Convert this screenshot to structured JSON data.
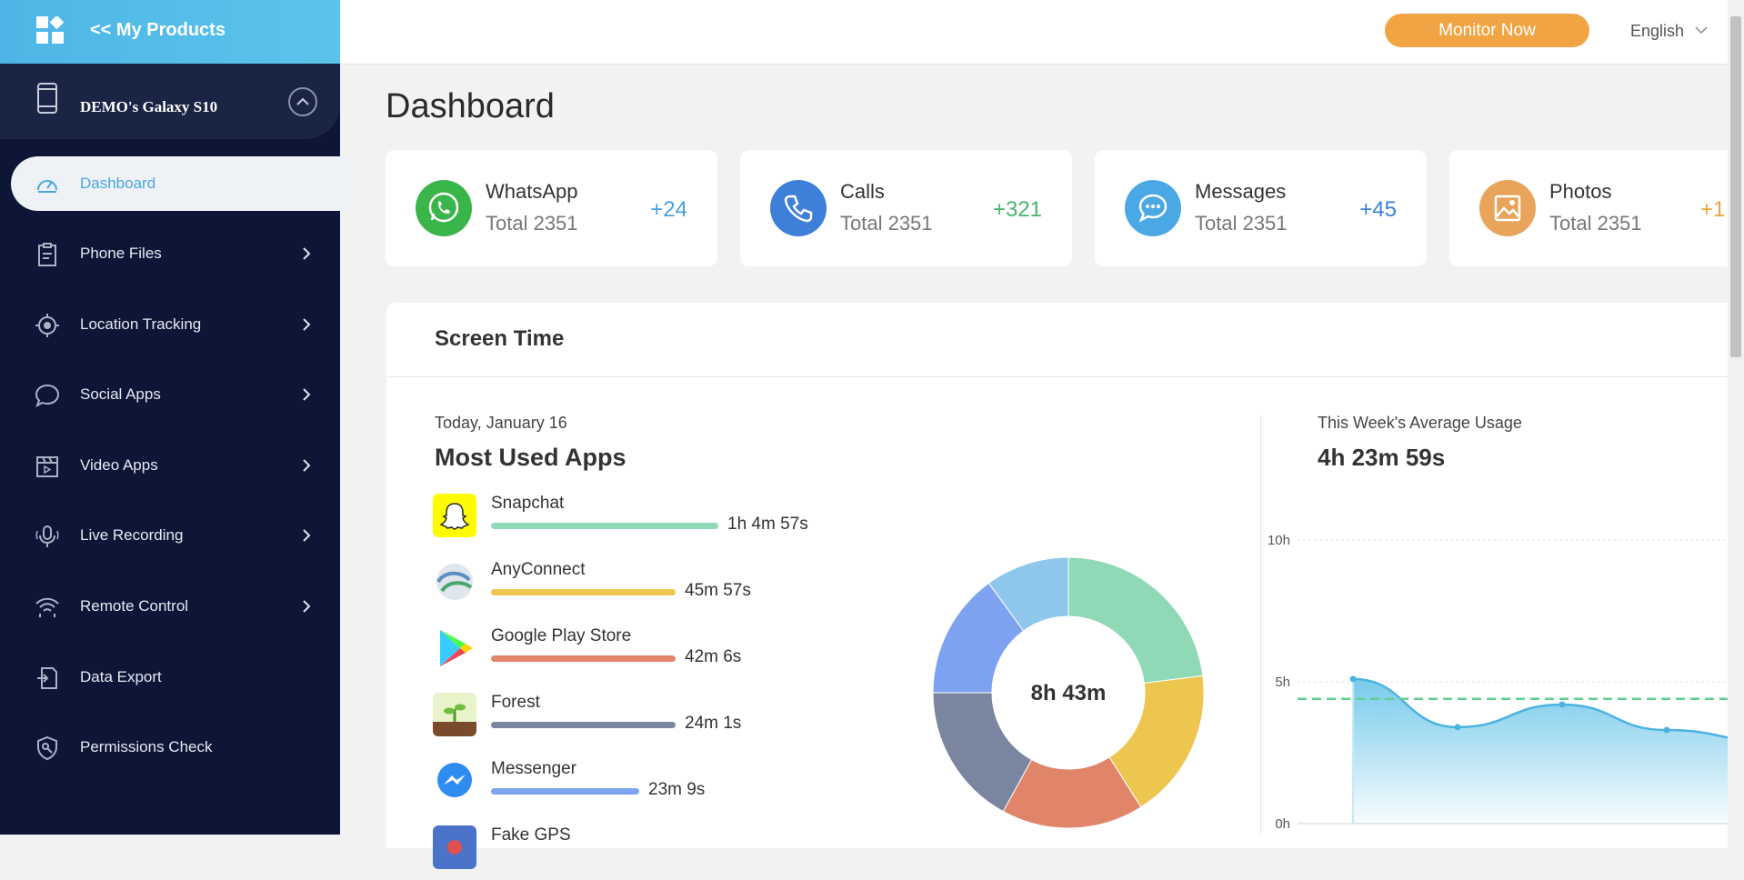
{
  "sidebar": {
    "top_title": "<< My Products",
    "device_name": "DEMO's Galaxy S10",
    "items": [
      {
        "label": "Dashboard",
        "icon": "gauge-icon",
        "active": true
      },
      {
        "label": "Phone Files",
        "icon": "clipboard-icon"
      },
      {
        "label": "Location Tracking",
        "icon": "crosshair-icon"
      },
      {
        "label": "Social Apps",
        "icon": "chat-bubble-icon"
      },
      {
        "label": "Video Apps",
        "icon": "clapperboard-icon"
      },
      {
        "label": "Live Recording",
        "icon": "microphone-icon"
      },
      {
        "label": "Remote Control",
        "icon": "wifi-icon"
      },
      {
        "label": "Data Export",
        "icon": "export-file-icon"
      },
      {
        "label": "Permissions Check",
        "icon": "shield-key-icon"
      }
    ]
  },
  "topbar": {
    "monitor_label": "Monitor Now",
    "language": "English"
  },
  "page_title": "Dashboard",
  "cards": [
    {
      "name": "WhatsApp",
      "total": "Total 2351",
      "delta": "+24",
      "color": "#3ab54a",
      "delta_color": "#4a9fe0",
      "icon": "whatsapp-icon"
    },
    {
      "name": "Calls",
      "total": "Total 2351",
      "delta": "+321",
      "color": "#3d7fd9",
      "delta_color": "#46b46b",
      "icon": "phone-icon"
    },
    {
      "name": "Messages",
      "total": "Total 2351",
      "delta": "+45",
      "color": "#4aa8e4",
      "delta_color": "#3d7fd9",
      "icon": "message-icon"
    },
    {
      "name": "Photos",
      "total": "Total 2351",
      "delta": "+1",
      "color": "#e8a45b",
      "delta_color": "#f0a443",
      "icon": "image-icon"
    }
  ],
  "screen_time": {
    "title": "Screen Time",
    "date": "Today, January 16",
    "most_used_title": "Most Used Apps",
    "total": "8h 43m",
    "apps": [
      {
        "name": "Snapchat",
        "time": "1h 4m 57s",
        "color": "#8fd9b6",
        "icon": "snapchat-icon",
        "fraction": 1.0
      },
      {
        "name": "AnyConnect",
        "time": "45m 57s",
        "color": "#ecc64f",
        "icon": "anyconnect-icon",
        "fraction": 0.81
      },
      {
        "name": "Google Play Store",
        "time": "42m 6s",
        "color": "#e0856a",
        "icon": "play-store-icon",
        "fraction": 0.81
      },
      {
        "name": "Forest",
        "time": "24m 1s",
        "color": "#7a86a0",
        "icon": "forest-icon",
        "fraction": 0.81
      },
      {
        "name": "Messenger",
        "time": "23m 9s",
        "color": "#7da2ef",
        "icon": "messenger-icon",
        "fraction": 0.65
      },
      {
        "name": "Fake GPS",
        "time": "",
        "color": "#8fc7ec",
        "icon": "fake-gps-icon",
        "fraction": 0
      }
    ],
    "weekly_label": "This Week's Average Usage",
    "weekly_value": "4h 23m 59s"
  },
  "chart_data": [
    {
      "type": "pie",
      "labels": [
        "Snapchat",
        "AnyConnect",
        "Google Play Store",
        "Forest",
        "Messenger",
        "Fake GPS"
      ],
      "values": [
        23,
        18,
        17,
        17,
        15,
        10
      ],
      "colors": [
        "#8fd9b6",
        "#ecc64f",
        "#e0856a",
        "#7a86a0",
        "#7da2ef",
        "#8fc7ec"
      ],
      "center_label": "8h 43m"
    },
    {
      "type": "area",
      "x": [
        0,
        1,
        2,
        3,
        4
      ],
      "values": [
        5.1,
        3.4,
        4.2,
        3.3,
        2.9
      ],
      "average": 4.4,
      "ylim": [
        0,
        10
      ],
      "yticks": [
        "0h",
        "5h",
        "10h"
      ],
      "line_color": "#4ab3e0",
      "avg_color": "#5fcf8f"
    }
  ]
}
